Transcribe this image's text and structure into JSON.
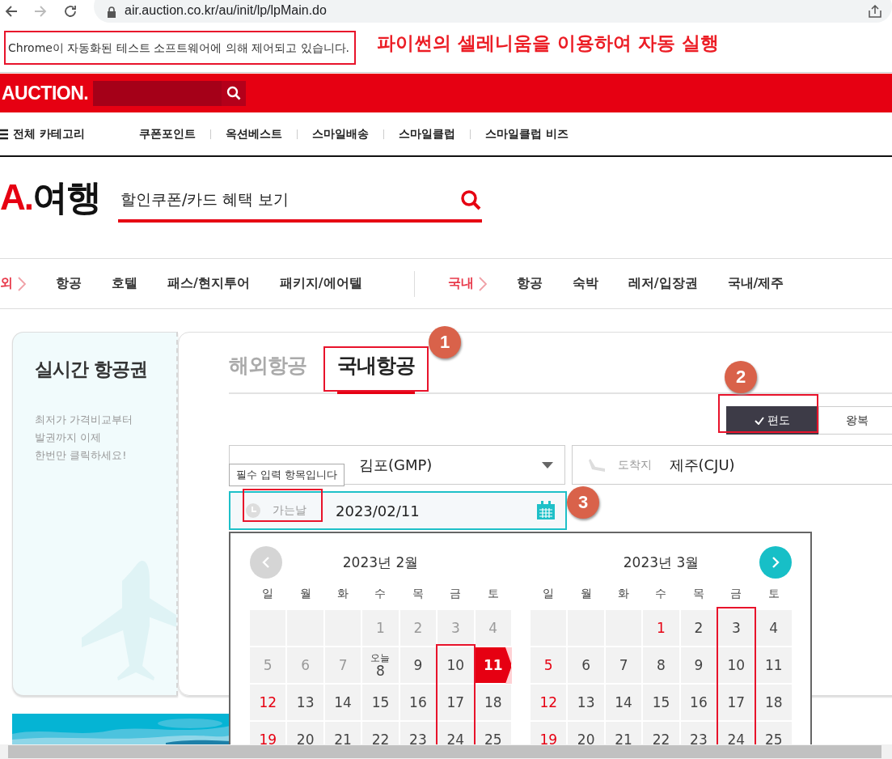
{
  "browser": {
    "url": "air.auction.co.kr/au/init/lp/lpMain.do"
  },
  "infobar": {
    "message": "Chrome이 자동화된 테스트 소프트웨어에 의해 제어되고 있습니다.",
    "caption": "파이썬의 셀레니움을 이용하여 자동 실행"
  },
  "header": {
    "logo": "AUCTION."
  },
  "category_nav": {
    "all_label": "전체 카테고리",
    "items": [
      "쿠폰포인트",
      "옥션베스트",
      "스마일배송",
      "스마일클럽",
      "스마일클럽 비즈"
    ]
  },
  "travel": {
    "logo_mark": "A.",
    "logo_text": "여행",
    "search_text": "할인쿠폰/카드 혜택 보기"
  },
  "travel_nav": {
    "groups": [
      {
        "label": "외",
        "items": [
          "항공",
          "호텔",
          "패스/현지투어",
          "패키지/에어텔"
        ]
      },
      {
        "label": "국내",
        "items": [
          "항공",
          "숙박",
          "레저/입장권",
          "국내/제주"
        ]
      }
    ]
  },
  "promo": {
    "title": "실시간 항공권",
    "lines": [
      "최저가 가격비교부터",
      "발권까지 이제",
      "한번만 클릭하세요!"
    ]
  },
  "tabs": [
    {
      "label": "해외항공",
      "selected": false
    },
    {
      "label": "국내항공",
      "selected": true
    }
  ],
  "trip_types": [
    {
      "label": "편도",
      "selected": true
    },
    {
      "label": "왕복",
      "selected": false
    }
  ],
  "departure": {
    "value": "김포(GMP)"
  },
  "arrival": {
    "label": "도착지",
    "value": "제주(CJU)"
  },
  "date_field": {
    "label": "가는날",
    "value": "2023/02/11",
    "tooltip": "필수 입력 항목입니다"
  },
  "calendar": {
    "months": [
      {
        "title": "2023년 2월",
        "kind": "prev",
        "nav_enabled": false,
        "weekdays": [
          "일",
          "월",
          "화",
          "수",
          "목",
          "금",
          "토"
        ],
        "weeks": [
          [
            {
              "kind": "empty"
            },
            {
              "kind": "empty"
            },
            {
              "kind": "empty"
            },
            {
              "day": "1",
              "kind": "past",
              "selected": false
            },
            {
              "day": "2",
              "kind": "past",
              "selected": false
            },
            {
              "day": "3",
              "kind": "past",
              "selected": false
            },
            {
              "day": "4",
              "kind": "past",
              "selected": false
            }
          ],
          [
            {
              "day": "5",
              "kind": "past",
              "selected": false
            },
            {
              "day": "6",
              "kind": "past",
              "selected": false
            },
            {
              "day": "7",
              "kind": "past",
              "selected": false
            },
            {
              "day": "8",
              "kind": "today",
              "note": "오늘",
              "selected": false
            },
            {
              "day": "9",
              "kind": "normal",
              "selected": false
            },
            {
              "day": "10",
              "kind": "normal",
              "selected": false
            },
            {
              "day": "11",
              "kind": "normal",
              "selected": true
            }
          ],
          [
            {
              "day": "12",
              "kind": "holiday",
              "selected": false
            },
            {
              "day": "13",
              "kind": "normal",
              "selected": false
            },
            {
              "day": "14",
              "kind": "normal",
              "selected": false
            },
            {
              "day": "15",
              "kind": "normal",
              "selected": false
            },
            {
              "day": "16",
              "kind": "normal",
              "selected": false
            },
            {
              "day": "17",
              "kind": "normal",
              "selected": false
            },
            {
              "day": "18",
              "kind": "normal",
              "selected": false
            }
          ],
          [
            {
              "day": "19",
              "kind": "holiday",
              "selected": false
            },
            {
              "day": "20",
              "kind": "normal",
              "selected": false
            },
            {
              "day": "21",
              "kind": "normal",
              "selected": false
            },
            {
              "day": "22",
              "kind": "normal",
              "selected": false
            },
            {
              "day": "23",
              "kind": "normal",
              "selected": false
            },
            {
              "day": "24",
              "kind": "normal",
              "selected": false
            },
            {
              "day": "25",
              "kind": "normal",
              "selected": false
            }
          ]
        ]
      },
      {
        "title": "2023년 3월",
        "kind": "next",
        "nav_enabled": true,
        "weekdays": [
          "일",
          "월",
          "화",
          "수",
          "목",
          "금",
          "토"
        ],
        "weeks": [
          [
            {
              "kind": "empty"
            },
            {
              "kind": "empty"
            },
            {
              "kind": "empty"
            },
            {
              "day": "1",
              "kind": "holiday",
              "selected": false
            },
            {
              "day": "2",
              "kind": "normal",
              "selected": false
            },
            {
              "day": "3",
              "kind": "normal",
              "selected": false
            },
            {
              "day": "4",
              "kind": "normal",
              "selected": false
            }
          ],
          [
            {
              "day": "5",
              "kind": "holiday",
              "selected": false
            },
            {
              "day": "6",
              "kind": "normal",
              "selected": false
            },
            {
              "day": "7",
              "kind": "normal",
              "selected": false
            },
            {
              "day": "8",
              "kind": "normal",
              "selected": false
            },
            {
              "day": "9",
              "kind": "normal",
              "selected": false
            },
            {
              "day": "10",
              "kind": "normal",
              "selected": false
            },
            {
              "day": "11",
              "kind": "normal",
              "selected": false
            }
          ],
          [
            {
              "day": "12",
              "kind": "holiday",
              "selected": false
            },
            {
              "day": "13",
              "kind": "normal",
              "selected": false
            },
            {
              "day": "14",
              "kind": "normal",
              "selected": false
            },
            {
              "day": "15",
              "kind": "normal",
              "selected": false
            },
            {
              "day": "16",
              "kind": "normal",
              "selected": false
            },
            {
              "day": "17",
              "kind": "normal",
              "selected": false
            },
            {
              "day": "18",
              "kind": "normal",
              "selected": false
            }
          ],
          [
            {
              "day": "19",
              "kind": "holiday",
              "selected": false
            },
            {
              "day": "20",
              "kind": "normal",
              "selected": false
            },
            {
              "day": "21",
              "kind": "normal",
              "selected": false
            },
            {
              "day": "22",
              "kind": "normal",
              "selected": false
            },
            {
              "day": "23",
              "kind": "normal",
              "selected": false
            },
            {
              "day": "24",
              "kind": "normal",
              "selected": false
            },
            {
              "day": "25",
              "kind": "normal",
              "selected": false
            }
          ]
        ]
      }
    ]
  },
  "step_badges": [
    "1",
    "2",
    "3"
  ]
}
